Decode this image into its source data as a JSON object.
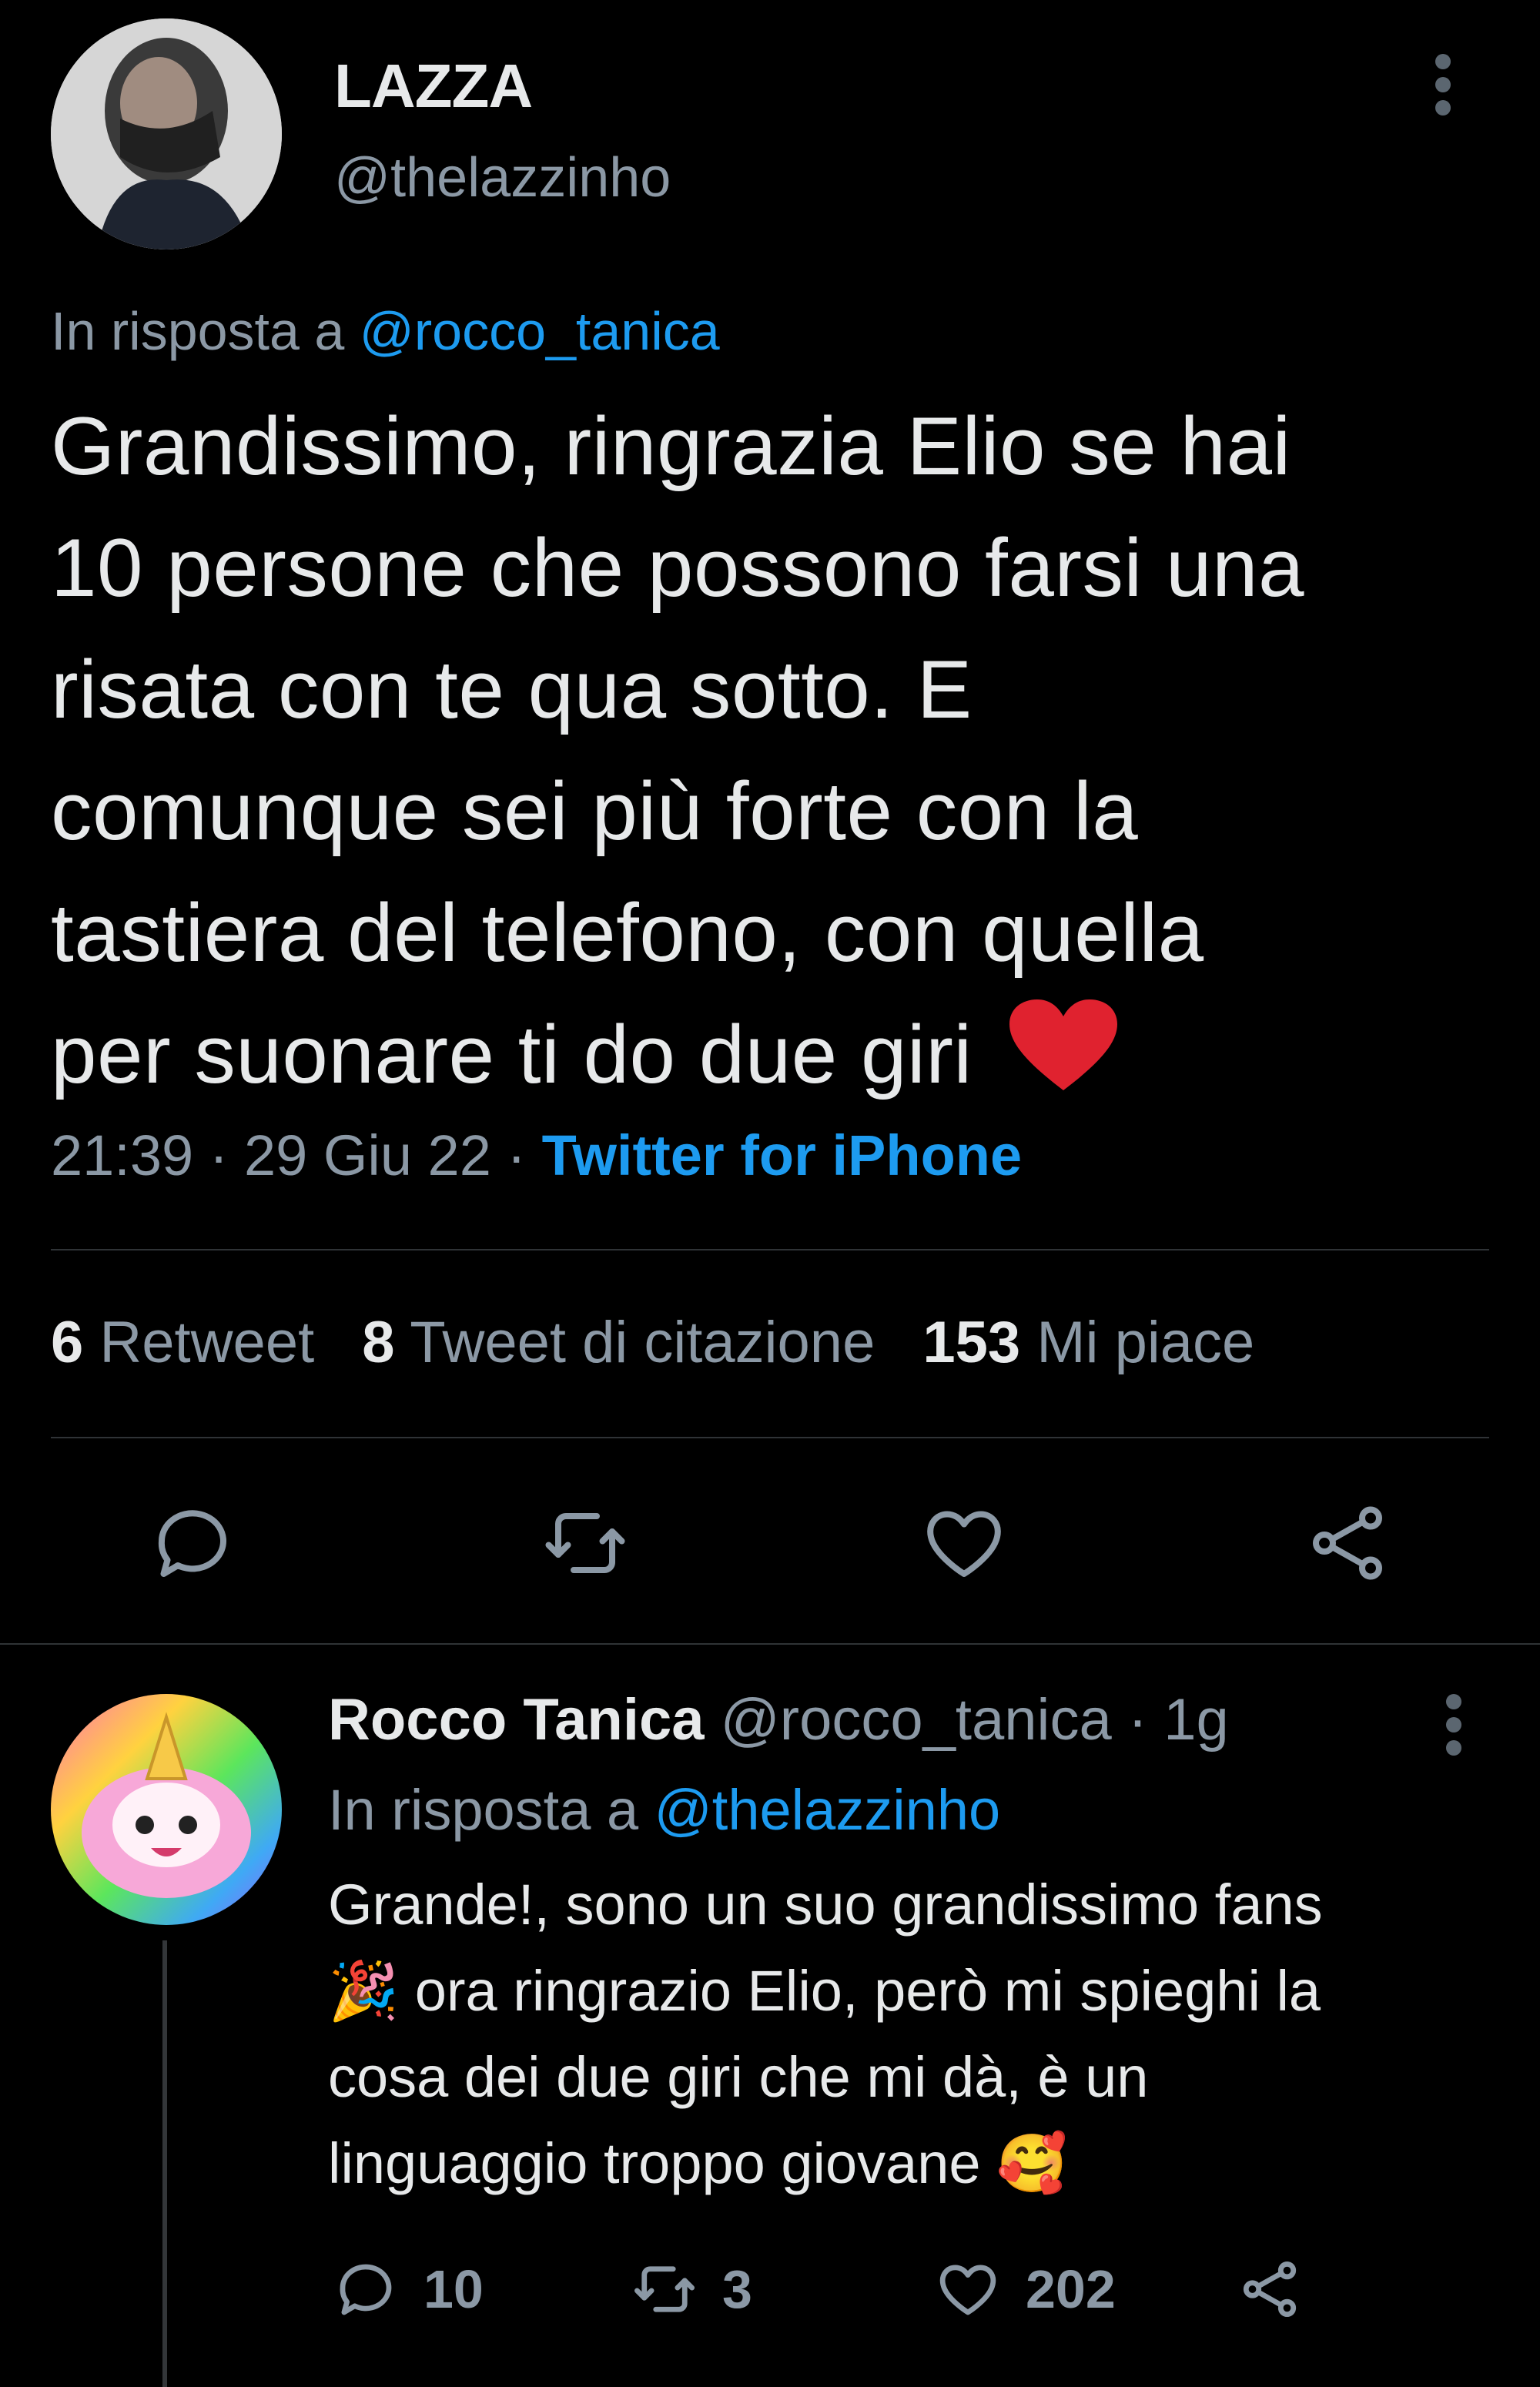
{
  "main_tweet": {
    "author_name": "LAZZA",
    "author_handle": "@thelazzinho",
    "reply_prefix": "In risposta a ",
    "reply_to": "@rocco_tanica",
    "text_lines": [
      "Grandissimo, ringrazia Elio se hai",
      "10 persone che possono farsi una",
      "risata con te qua sotto. E",
      "comunque sei più forte con la",
      "tastiera del telefono, con quella",
      "per suonare ti do due giri"
    ],
    "emoji": "❤️",
    "time": "21:39",
    "date": "29 Giu 22",
    "separator": " · ",
    "source": "Twitter for iPhone",
    "stats": {
      "retweets_count": "6",
      "retweets_label": " Retweet",
      "quotes_count": "8",
      "quotes_label": " Tweet di citazione",
      "likes_count": "153",
      "likes_label": " Mi piace"
    }
  },
  "reply_tweet": {
    "author_name": "Rocco Tanica",
    "author_handle": "@rocco_tanica",
    "age": " · 1g",
    "reply_prefix": "In risposta a ",
    "reply_to": "@thelazzinho",
    "text_lines": [
      "Grande!, sono un suo grandissimo fans",
      "🎉 ora ringrazio Elio, però mi spieghi la",
      "cosa dei due giri che mi dà, è un",
      "linguaggio troppo giovane 🥰"
    ],
    "reply_count": "10",
    "retweet_count": "3",
    "like_count": "202"
  },
  "icons": {
    "reply": "speech-bubble-icon",
    "retweet": "retweet-arrows-icon",
    "like": "heart-icon",
    "share": "share-icon",
    "more": "vertical-ellipsis-icon"
  },
  "colors": {
    "background": "#000000",
    "text": "#e7e9ea",
    "muted": "#8b98a5",
    "link": "#1d9bf0",
    "heart_emoji": "#e0222f",
    "divider": "#2f3336"
  }
}
